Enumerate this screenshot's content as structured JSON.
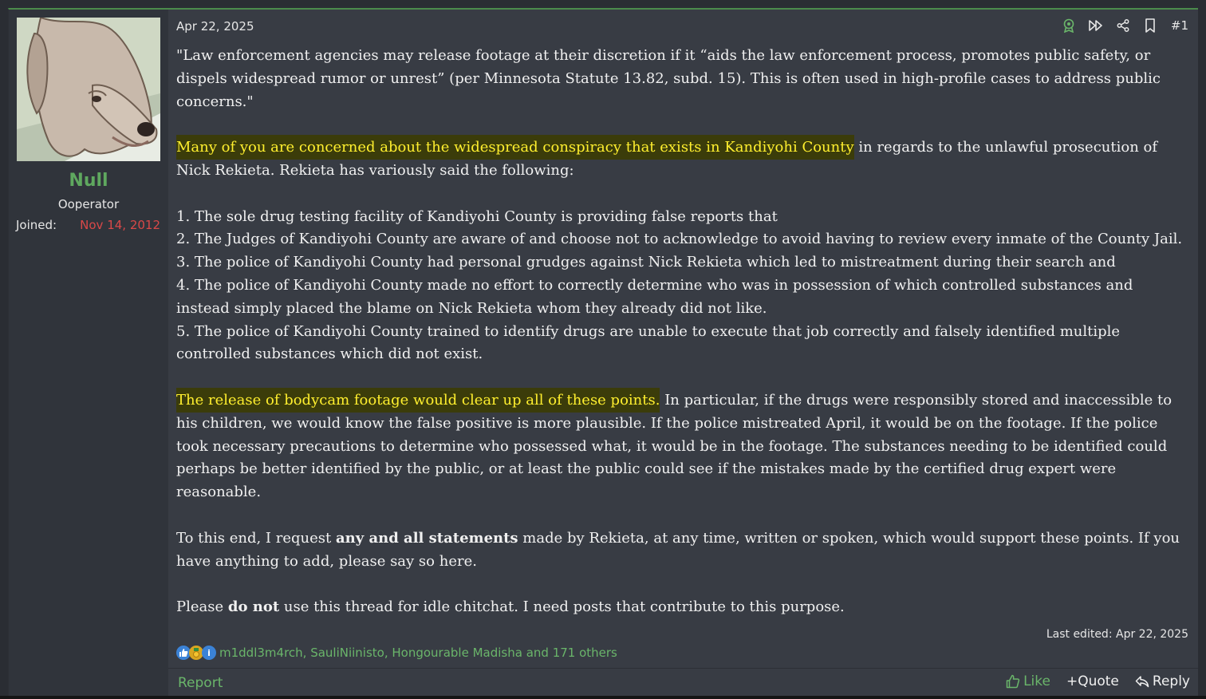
{
  "user": {
    "name": "Null",
    "title": "Ooperator",
    "joined_label": "Joined:",
    "joined_date": "Nov 14, 2012"
  },
  "post": {
    "date": "Apr 22, 2025",
    "number": "#1",
    "quote": "\"Law enforcement agencies may release footage at their discretion if it “aids the law enforcement process, promotes public safety, or dispels widespread rumor or unrest” (per Minnesota Statute 13.82, subd. 15). This is often used in high-profile cases to address public concerns.\"",
    "para2_highlight": "Many of you are concerned about the widespread conspiracy that exists in Kandiyohi County",
    "para2_rest": " in regards to the unlawful prosecution of Nick Rekieta. Rekieta has variously said the following:",
    "list": [
      "1. The sole drug testing facility of Kandiyohi County is providing false reports that",
      "2. The Judges of Kandiyohi County are aware of and choose not to acknowledge to avoid having to review every inmate of the County Jail.",
      "3. The police of Kandiyohi County had personal grudges against Nick Rekieta which led to mistreatment during their search and",
      "4. The police of Kandiyohi County made no effort to correctly determine who was in possession of which controlled substances and instead simply placed the blame on Nick Rekieta whom they already did not like.",
      "5. The police of Kandiyohi County trained to identify drugs are unable to execute that job correctly and falsely identified multiple controlled substances which did not exist."
    ],
    "para3_highlight": "The release of bodycam footage would clear up all of these points.",
    "para3_rest": " In particular, if the drugs were responsibly stored and inaccessible to his children, we would know the false positive is more plausible. If the police mistreated April, it would be on the footage. If the police took necessary precautions to determine who possessed what, it would be in the footage. The substances needing to be identified could perhaps be better identified by the public, or at least the public could see if the mistakes made by the certified drug expert were reasonable.",
    "para4_a": "To this end, I request ",
    "para4_bold": "any and all statements",
    "para4_b": " made by Rekieta, at any time, written or spoken, which would support these points. If you have anything to add, please say so here.",
    "para5_a": "Please ",
    "para5_bold": "do not",
    "para5_b": " use this thread for idle chitchat. I need posts that contribute to this purpose.",
    "last_edited": "Last edited: Apr 22, 2025"
  },
  "reactions": {
    "names": "m1ddl3m4rch, SauliNiinisto, Hongourable Madisha and 171 others",
    "icons": [
      "thumbs-up-icon",
      "medal-icon",
      "info-icon"
    ]
  },
  "footer": {
    "report": "Report",
    "like": "Like",
    "quote": "+Quote",
    "reply": "Reply"
  },
  "colors": {
    "accent_green": "#6ab56a",
    "highlight_text": "#ffef2e",
    "highlight_bg": "#3b3c0a",
    "joined_date": "#d94848"
  }
}
